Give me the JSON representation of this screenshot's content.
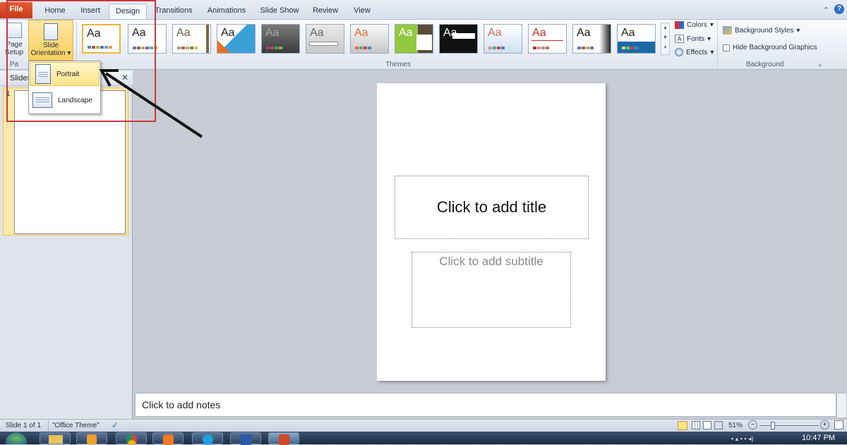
{
  "tabs": [
    "File",
    "Home",
    "Insert",
    "Design",
    "Transitions",
    "Animations",
    "Slide Show",
    "Review",
    "View"
  ],
  "page_setup": {
    "label_line1": "Page",
    "label_line2": "Setup"
  },
  "slide_orientation": {
    "label_line1": "Slide",
    "label_line2": "Orientation"
  },
  "group_page_short": "Pa",
  "themes_label": "Themes",
  "background_label": "Background",
  "theme_sample": "Aa",
  "colors_label": "Colors",
  "fonts_label": "Fonts",
  "effects_label": "Effects",
  "background_styles_label": "Background Styles",
  "hide_bg_label": "Hide Background Graphics",
  "dropdown": {
    "portrait": "Portrait",
    "landscape": "Landscape"
  },
  "slides_tab": "Slides",
  "thumb_number": "1",
  "slide": {
    "title": "Click to add title",
    "subtitle": "Click to add subtitle"
  },
  "notes": "Click to add notes",
  "status": {
    "slide": "Slide 1 of 1",
    "theme": "\"Office Theme\"",
    "zoom": "51%"
  },
  "clock": "10:47 PM"
}
